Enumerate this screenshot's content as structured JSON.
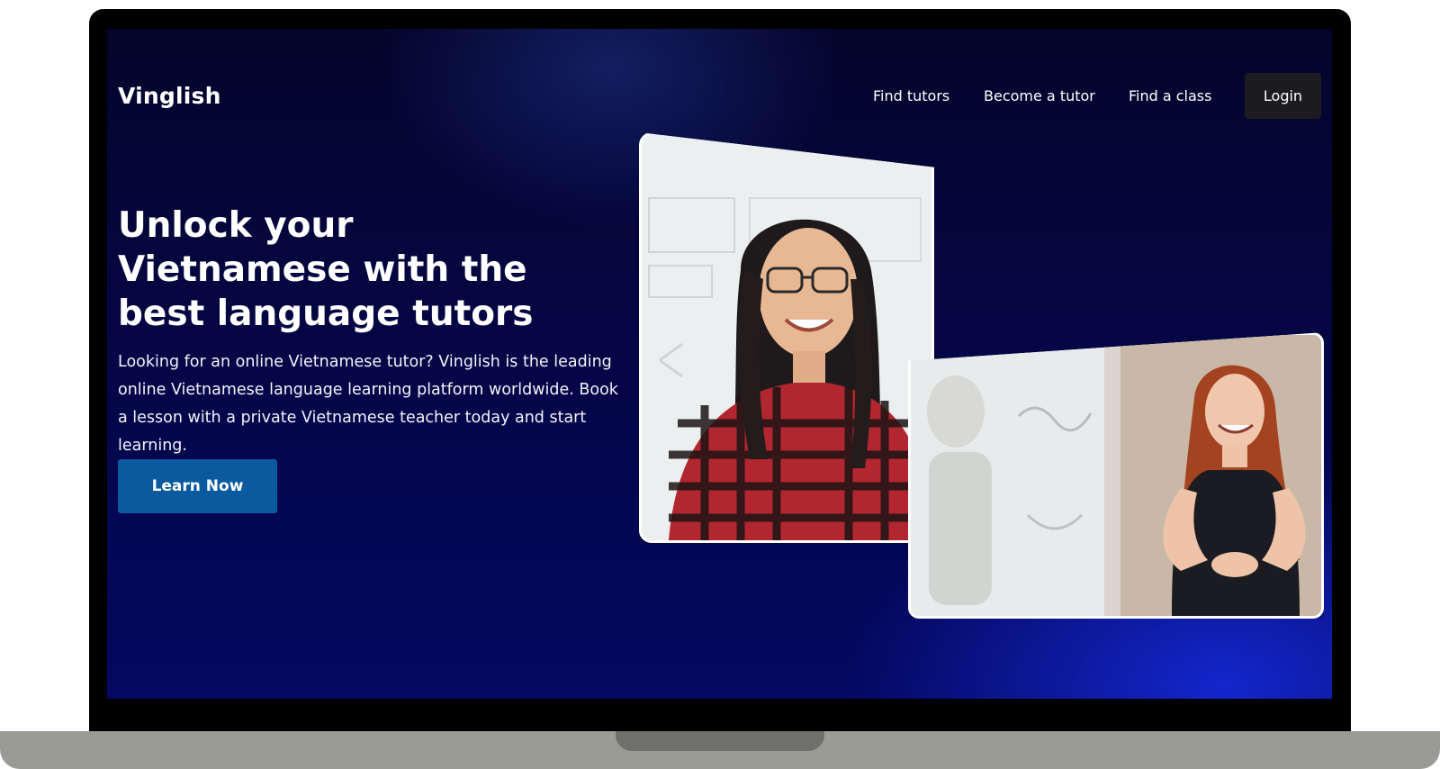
{
  "nav": {
    "brand": "Vinglish",
    "links": [
      "Find tutors",
      "Become a tutor",
      "Find a class"
    ],
    "login": "Login"
  },
  "hero": {
    "title": "Unlock your Vietnamese with the best language tutors",
    "description": "Looking for an online Vietnamese tutor? Vinglish is the leading online Vietnamese language learning platform worldwide. Book a lesson with a private Vietnamese teacher today and start learning.",
    "cta": "Learn Now"
  },
  "colors": {
    "background_top": "#03052b",
    "background_bottom": "#040860",
    "accent_glow": "#1428d2",
    "cta_button": "#0a5aa0",
    "login_button": "#1b1b20",
    "text": "#ffffff"
  },
  "images": [
    {
      "name": "tutor-photo-woman-glasses",
      "alt": "Smiling tutor with glasses in front of a whiteboard"
    },
    {
      "name": "tutor-photo-woman-whiteboard",
      "alt": "Smiling tutor standing by a whiteboard"
    }
  ]
}
